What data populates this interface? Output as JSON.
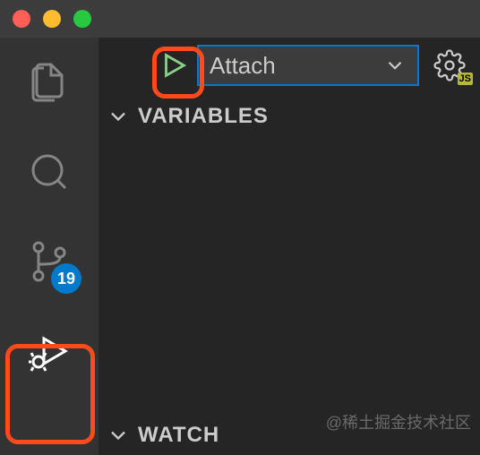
{
  "titlebar": {},
  "activityBar": {
    "scmBadge": "19"
  },
  "debug": {
    "configSelected": "Attach",
    "gearJs": "JS"
  },
  "sections": {
    "variables": "VARIABLES",
    "watch": "WATCH"
  },
  "watermark": "@稀土掘金技术社区"
}
